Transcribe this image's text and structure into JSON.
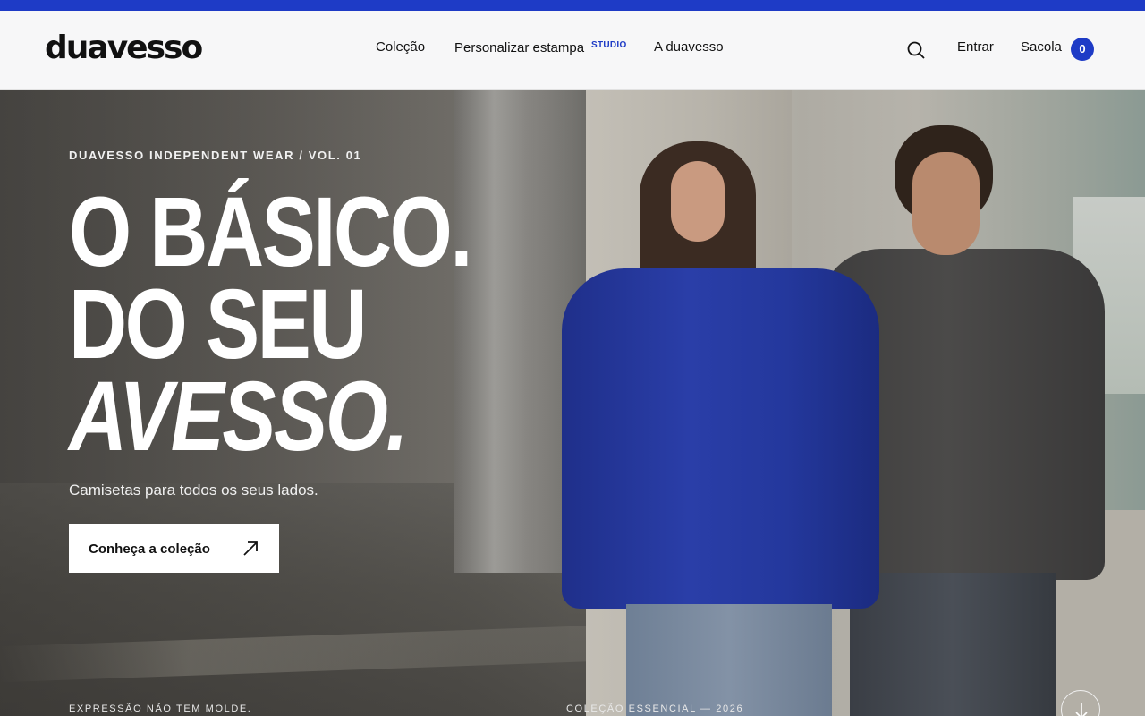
{
  "brand": {
    "logo_text_pre": "dua",
    "logo_text_accent": "v",
    "logo_text_post": "esso",
    "accent_color": "#1e3bc6"
  },
  "nav": {
    "colecao": "Coleção",
    "personalizar": "Personalizar estampa",
    "studio_badge": "STUDIO",
    "sobre": "A duavesso"
  },
  "header_actions": {
    "search_icon": "search-icon",
    "entrar": "Entrar",
    "sacola": "Sacola",
    "cart_count": "0"
  },
  "hero": {
    "eyebrow": "DUAVESSO INDEPENDENT WEAR / VOL. 01",
    "headline_line1": "O BÁSICO.",
    "headline_line2": "DO SEU",
    "headline_line3": "AVESSO.",
    "subtitle": "Camisetas para todos os seus lados.",
    "cta_label": "Conheça a coleção",
    "cta_icon": "arrow-up-right-icon",
    "footer_left": "EXPRESSÃO NÃO TEM MOLDE.",
    "footer_mid": "COLEÇÃO ESSENCIAL — 2026",
    "scroll_icon": "arrow-down-icon"
  }
}
